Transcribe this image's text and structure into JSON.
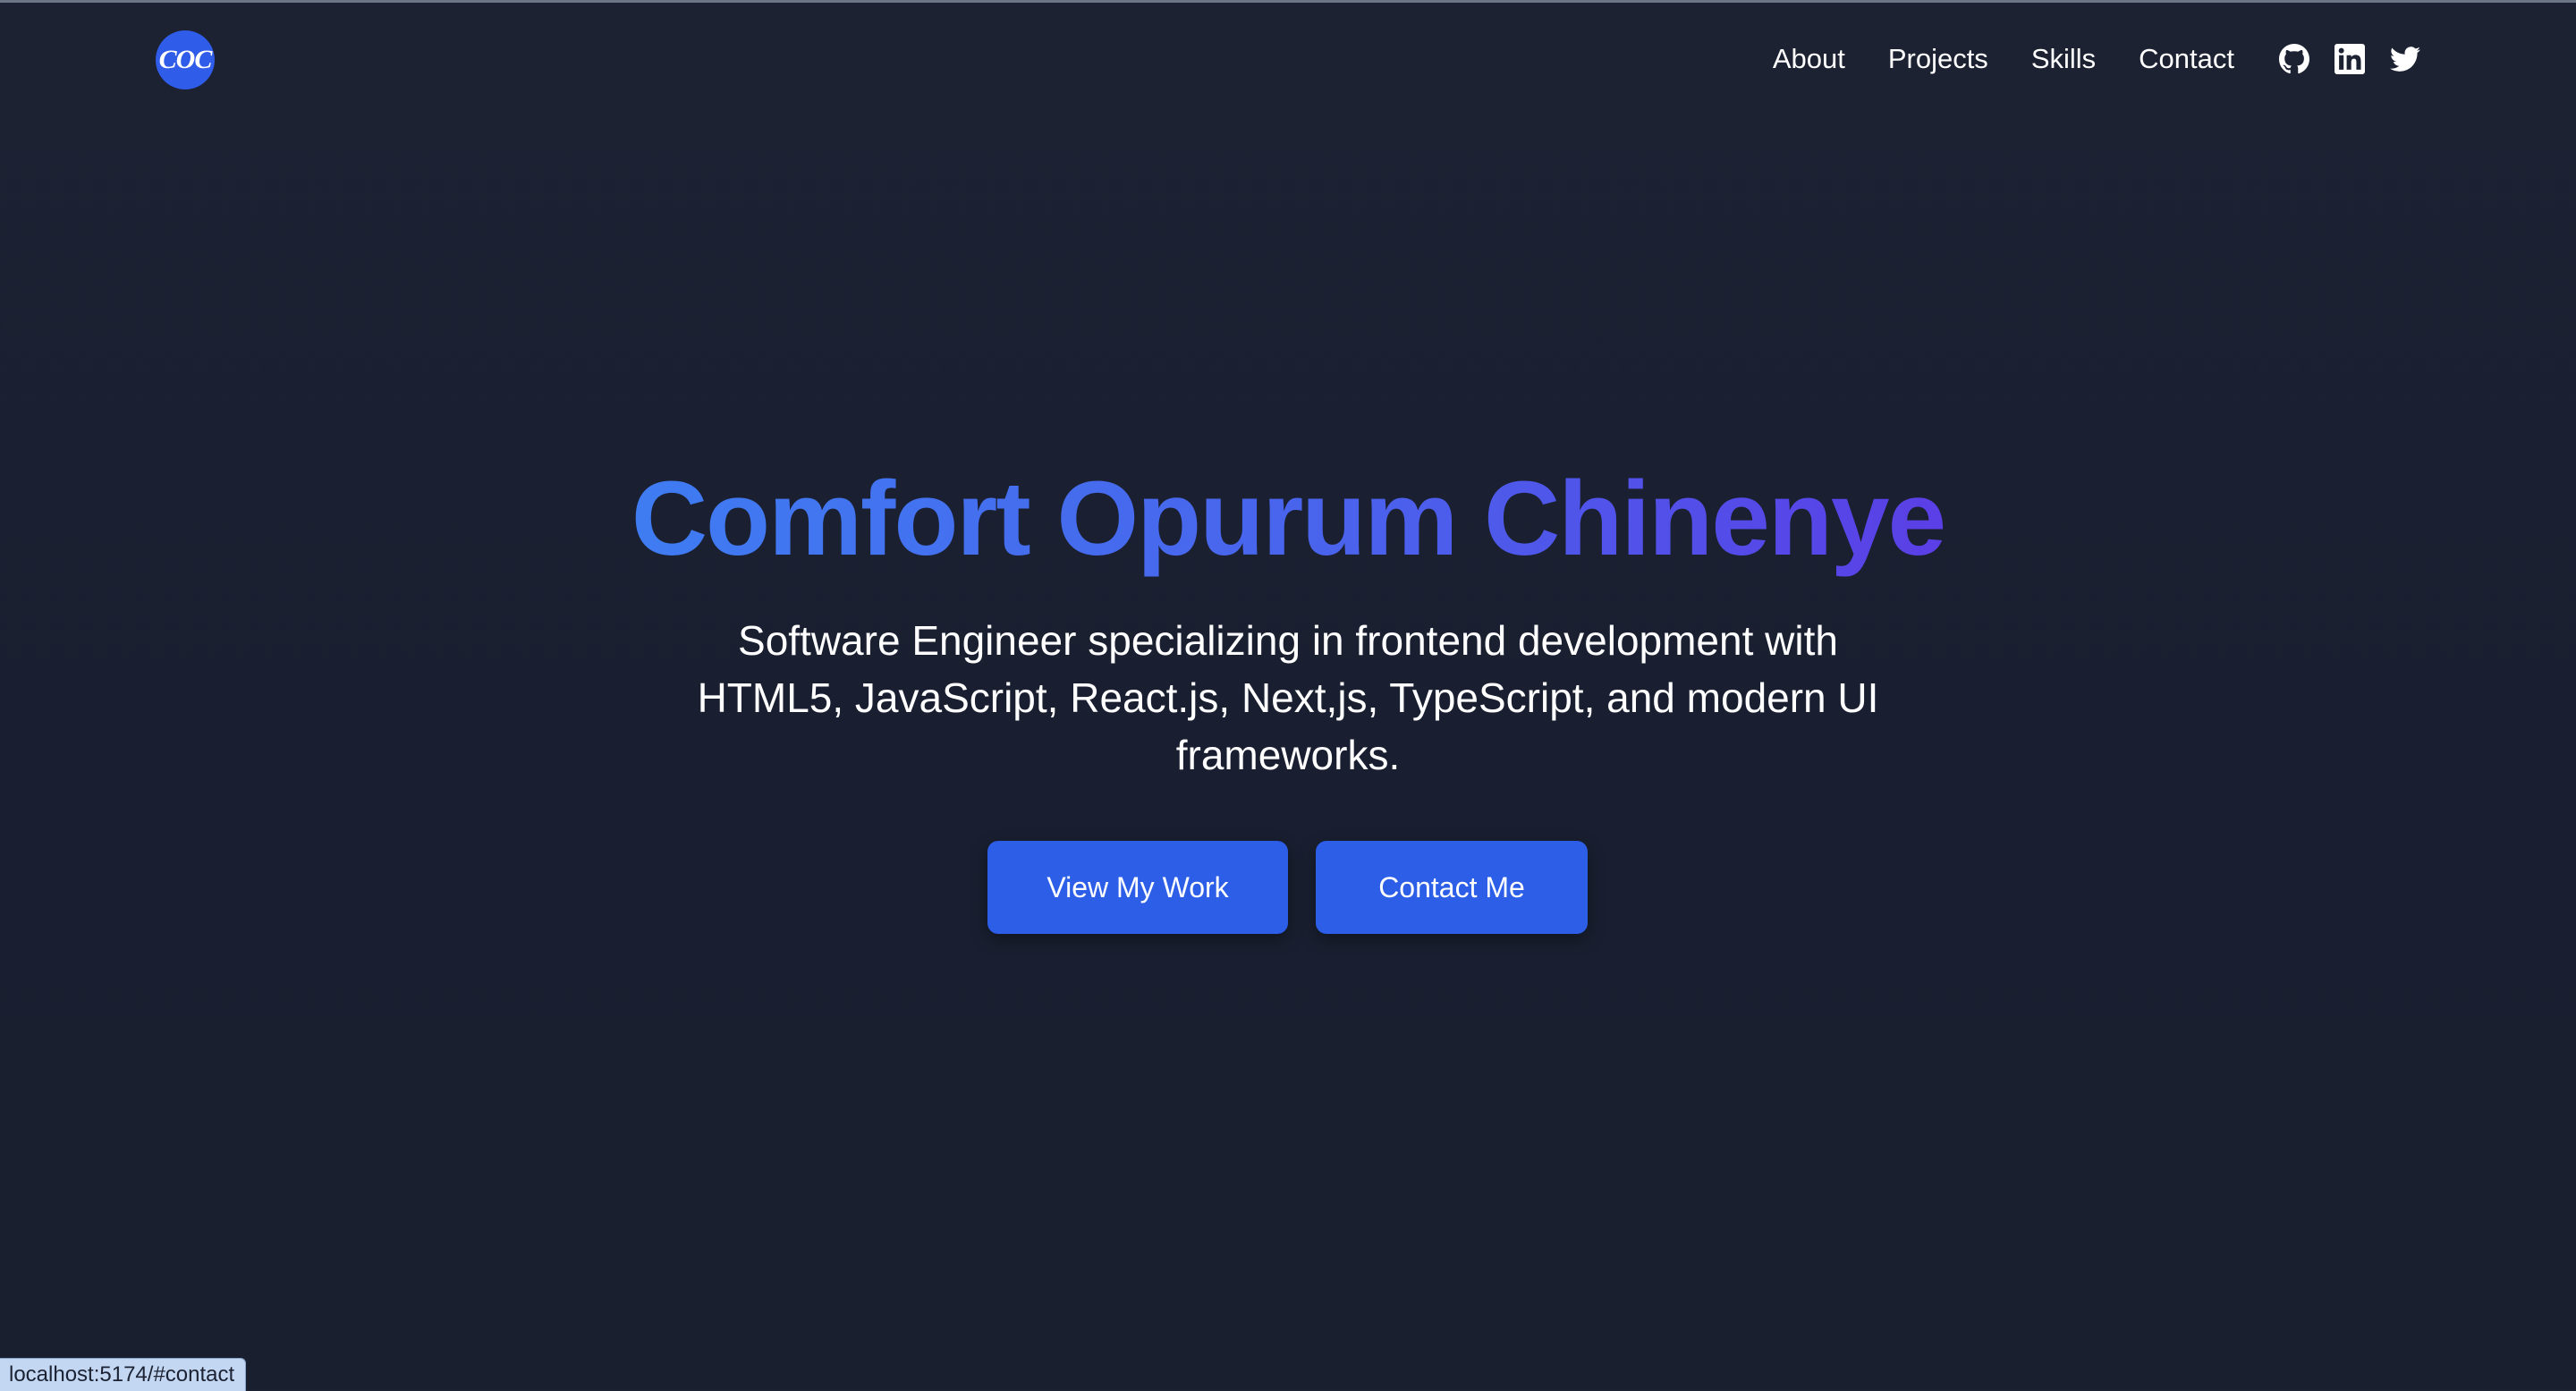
{
  "logo": {
    "text": "COC"
  },
  "nav": {
    "links": [
      {
        "label": "About"
      },
      {
        "label": "Projects"
      },
      {
        "label": "Skills"
      },
      {
        "label": "Contact"
      }
    ],
    "social_icons": [
      "github-icon",
      "linkedin-icon",
      "twitter-icon"
    ]
  },
  "hero": {
    "title": "Comfort Opurum Chinenye",
    "subtitle": "Software Engineer specializing in frontend development with HTML5, JavaScript, React.js, Next,js, TypeScript, and modern UI frameworks.",
    "primary_button": "View My Work",
    "secondary_button": "Contact Me"
  },
  "status_bar": {
    "url": "localhost:5174/#contact"
  },
  "colors": {
    "background": "#1b2131",
    "accent": "#2c5ee8",
    "title_gradient_start": "#3f7cf2",
    "title_gradient_end": "#5a3fe6"
  }
}
